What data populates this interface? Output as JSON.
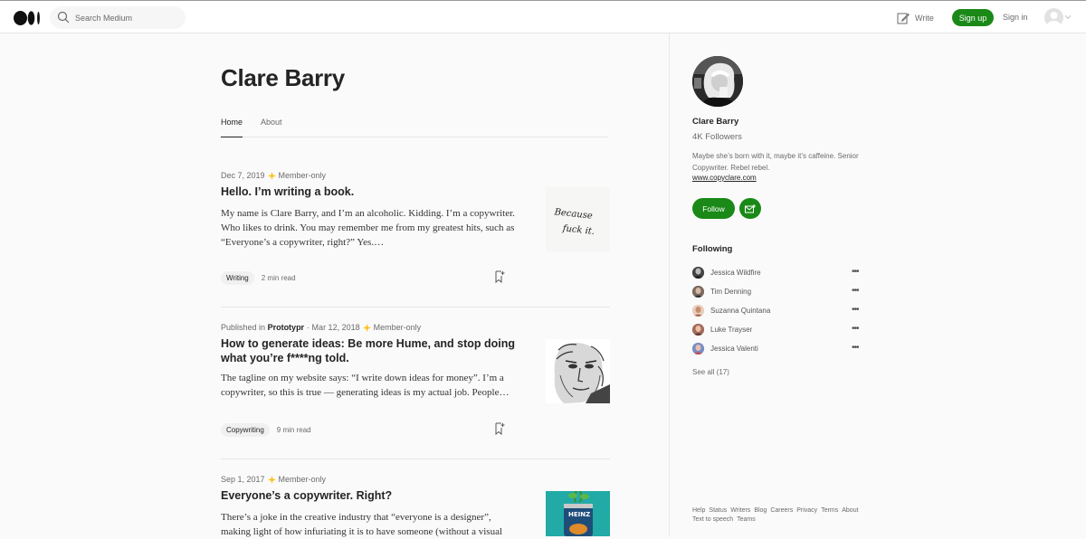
{
  "header": {
    "search_placeholder": "Search Medium",
    "write_label": "Write",
    "signup_label": "Sign up",
    "signin_label": "Sign in"
  },
  "author": {
    "name": "Clare Barry",
    "tabs": [
      {
        "label": "Home"
      },
      {
        "label": "About"
      }
    ]
  },
  "articles": [
    {
      "date": "Dec 7, 2019",
      "member_only": "Member-only",
      "title": "Hello. I’m writing a book.",
      "excerpt": "My name is Clare Barry, and I’m an alcoholic. Kidding. I’m a copywriter. Who likes to drink. You may remember me from my greatest hits, such as “Everyone’s a copywriter, right?” Yes.…",
      "tag": "Writing",
      "read_time": "2 min read",
      "thumb_text": "Because fuck it."
    },
    {
      "published_prefix": "Published in",
      "publication": "Prototypr",
      "date": "· Mar 12, 2018",
      "member_only": "Member-only",
      "title": "How to generate ideas: Be more Hume, and stop doing what you’re f****ng told.",
      "excerpt": "The tagline on my website says: “I write down ideas for money”. I’m a copywriter, so this is true — generating ideas is my actual job. People…",
      "tag": "Copywriting",
      "read_time": "9 min read"
    },
    {
      "date": "Sep 1, 2017",
      "member_only": "Member-only",
      "title": "Everyone’s a copywriter. Right?",
      "excerpt": "There’s a joke in the creative industry that “everyone is a designer”, making light of how infuriating it is to have someone (without a visual",
      "thumb_text": "HEINZ"
    }
  ],
  "sidebar": {
    "name": "Clare Barry",
    "followers": "4K Followers",
    "bio": "Maybe she’s born with it, maybe it’s caffeine. Senior Copywriter. Rebel rebel.",
    "website": "www.copyclare.com",
    "follow_label": "Follow",
    "following_heading": "Following",
    "following": [
      {
        "name": "Jessica Wildfire"
      },
      {
        "name": "Tim Denning"
      },
      {
        "name": "Suzanna Quintana"
      },
      {
        "name": "Luke Trayser"
      },
      {
        "name": "Jessica Valenti"
      }
    ],
    "see_all": "See all (17)",
    "footer": [
      "Help",
      "Status",
      "Writers",
      "Blog",
      "Careers",
      "Privacy",
      "Terms",
      "About",
      "Text to speech",
      "Teams"
    ]
  },
  "colors": {
    "accent_green": "#1a8917",
    "member_star": "#ffc017"
  }
}
